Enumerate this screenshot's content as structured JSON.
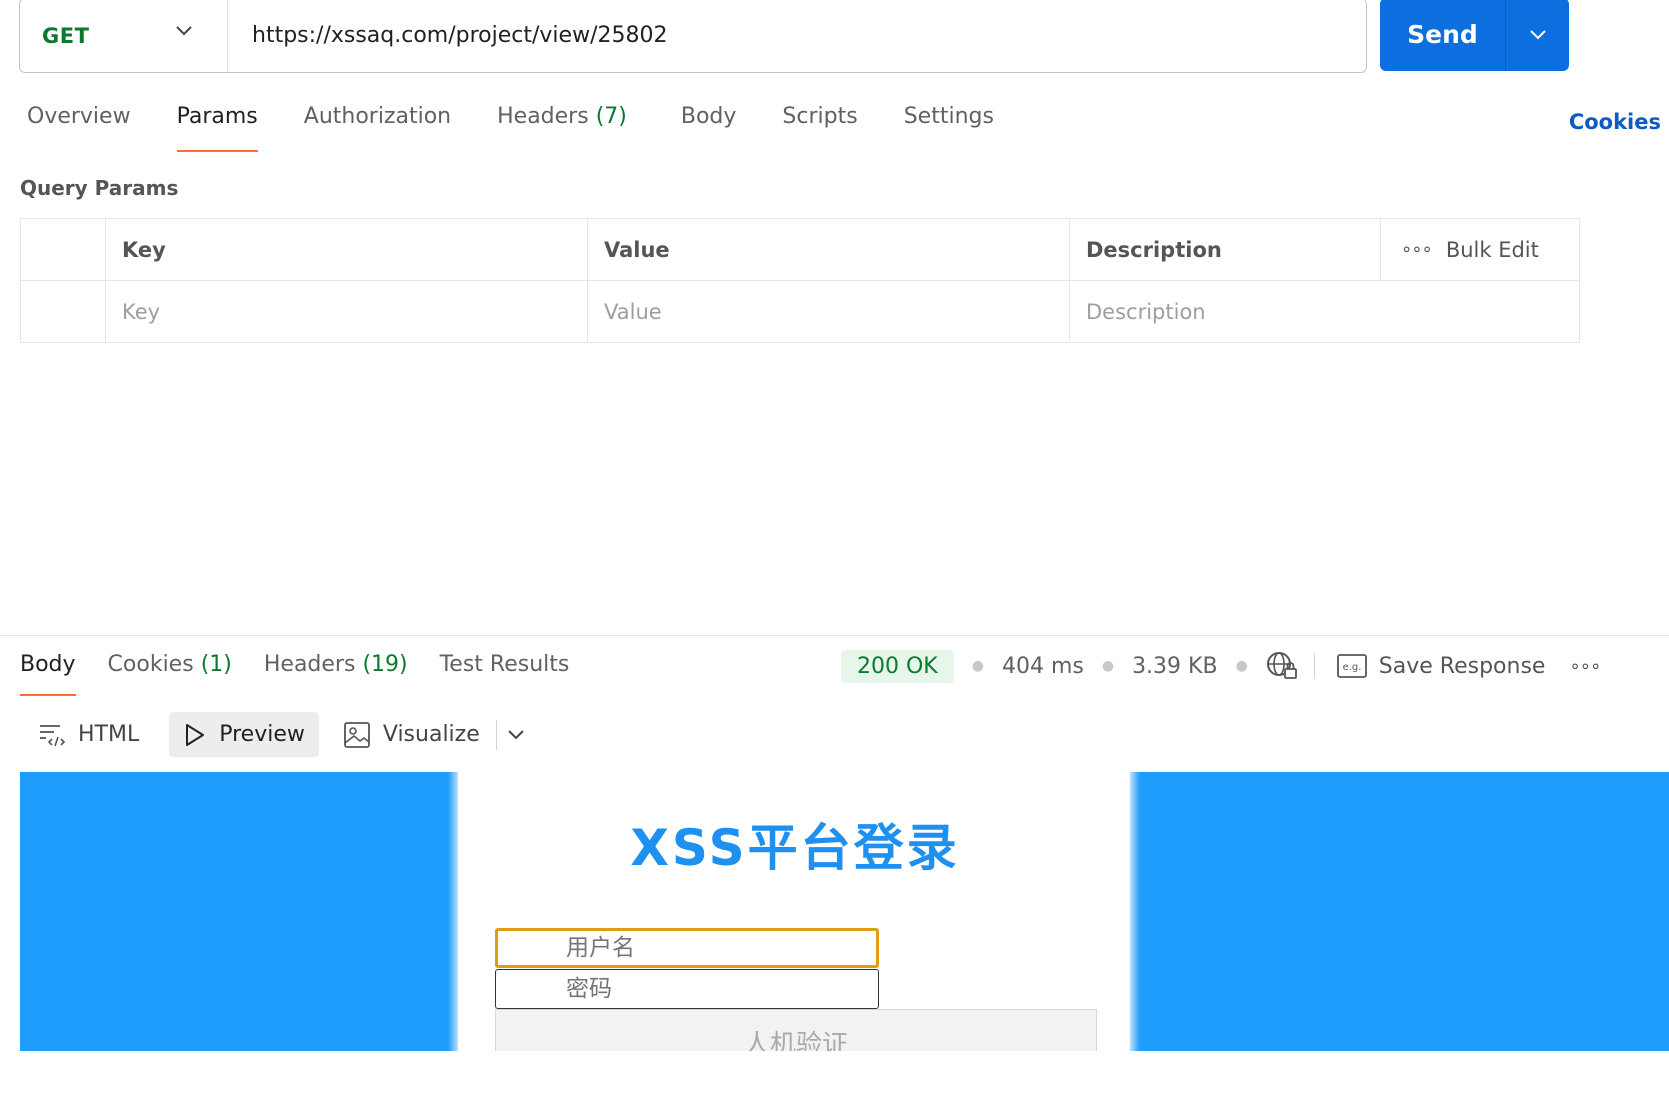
{
  "request": {
    "method": "GET",
    "url": "https://xssaq.com/project/view/25802",
    "send_label": "Send"
  },
  "request_tabs": [
    {
      "label": "Overview",
      "count": ""
    },
    {
      "label": "Params",
      "count": ""
    },
    {
      "label": "Authorization",
      "count": ""
    },
    {
      "label": "Headers",
      "count": "(7)"
    },
    {
      "label": "Body",
      "count": ""
    },
    {
      "label": "Scripts",
      "count": ""
    },
    {
      "label": "Settings",
      "count": ""
    }
  ],
  "cookies_link": "Cookies",
  "params": {
    "section_title": "Query Params",
    "columns": [
      "Key",
      "Value",
      "Description"
    ],
    "bulk_edit": "Bulk Edit",
    "placeholders": {
      "key": "Key",
      "value": "Value",
      "description": "Description"
    }
  },
  "response_tabs": [
    {
      "label": "Body",
      "count": ""
    },
    {
      "label": "Cookies",
      "count": "(1)"
    },
    {
      "label": "Headers",
      "count": "(19)"
    },
    {
      "label": "Test Results",
      "count": ""
    }
  ],
  "response_meta": {
    "status": "200 OK",
    "time": "404 ms",
    "size": "3.39 KB",
    "save_label": "Save Response",
    "save_icon_text": "e.g."
  },
  "view_modes": {
    "html": "HTML",
    "preview": "Preview",
    "visualize": "Visualize"
  },
  "preview_page": {
    "title": "XSS平台登录",
    "username_placeholder": "用户名",
    "password_placeholder": "密码",
    "captcha_label": "人机验证"
  },
  "colors": {
    "accent": "#0c6fe0",
    "tab_underline": "#ff6c37",
    "method_green": "#0b7a2f",
    "preview_blue": "#1e9dfd"
  }
}
